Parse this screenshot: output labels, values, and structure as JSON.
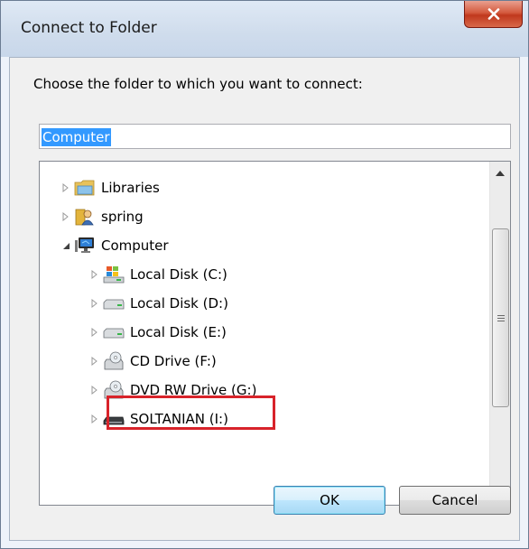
{
  "window": {
    "title": "Connect to Folder"
  },
  "dialog": {
    "prompt": "Choose the folder to which you want to connect:",
    "folder_input": {
      "value": "Computer"
    },
    "tree": [
      {
        "label": "Libraries",
        "icon": "libraries-icon",
        "expanded": false,
        "level": 0
      },
      {
        "label": "spring",
        "icon": "user-folder-icon",
        "expanded": false,
        "level": 0
      },
      {
        "label": "Computer",
        "icon": "computer-icon",
        "expanded": true,
        "level": 0
      },
      {
        "label": "Local Disk (C:)",
        "icon": "system-drive-icon",
        "expanded": false,
        "level": 1
      },
      {
        "label": "Local Disk (D:)",
        "icon": "hard-drive-icon",
        "expanded": false,
        "level": 1
      },
      {
        "label": "Local Disk (E:)",
        "icon": "hard-drive-icon",
        "expanded": false,
        "level": 1
      },
      {
        "label": "CD Drive (F:)",
        "icon": "cd-drive-icon",
        "expanded": false,
        "level": 1
      },
      {
        "label": "DVD RW Drive (G:)",
        "icon": "dvd-drive-icon",
        "expanded": false,
        "level": 1
      },
      {
        "label": "SOLTANIAN (I:)",
        "icon": "removable-drive-icon",
        "expanded": false,
        "level": 1
      }
    ],
    "buttons": {
      "ok": "OK",
      "cancel": "Cancel"
    }
  },
  "colors": {
    "highlight": "#d8232a",
    "selection": "#3399ff"
  }
}
